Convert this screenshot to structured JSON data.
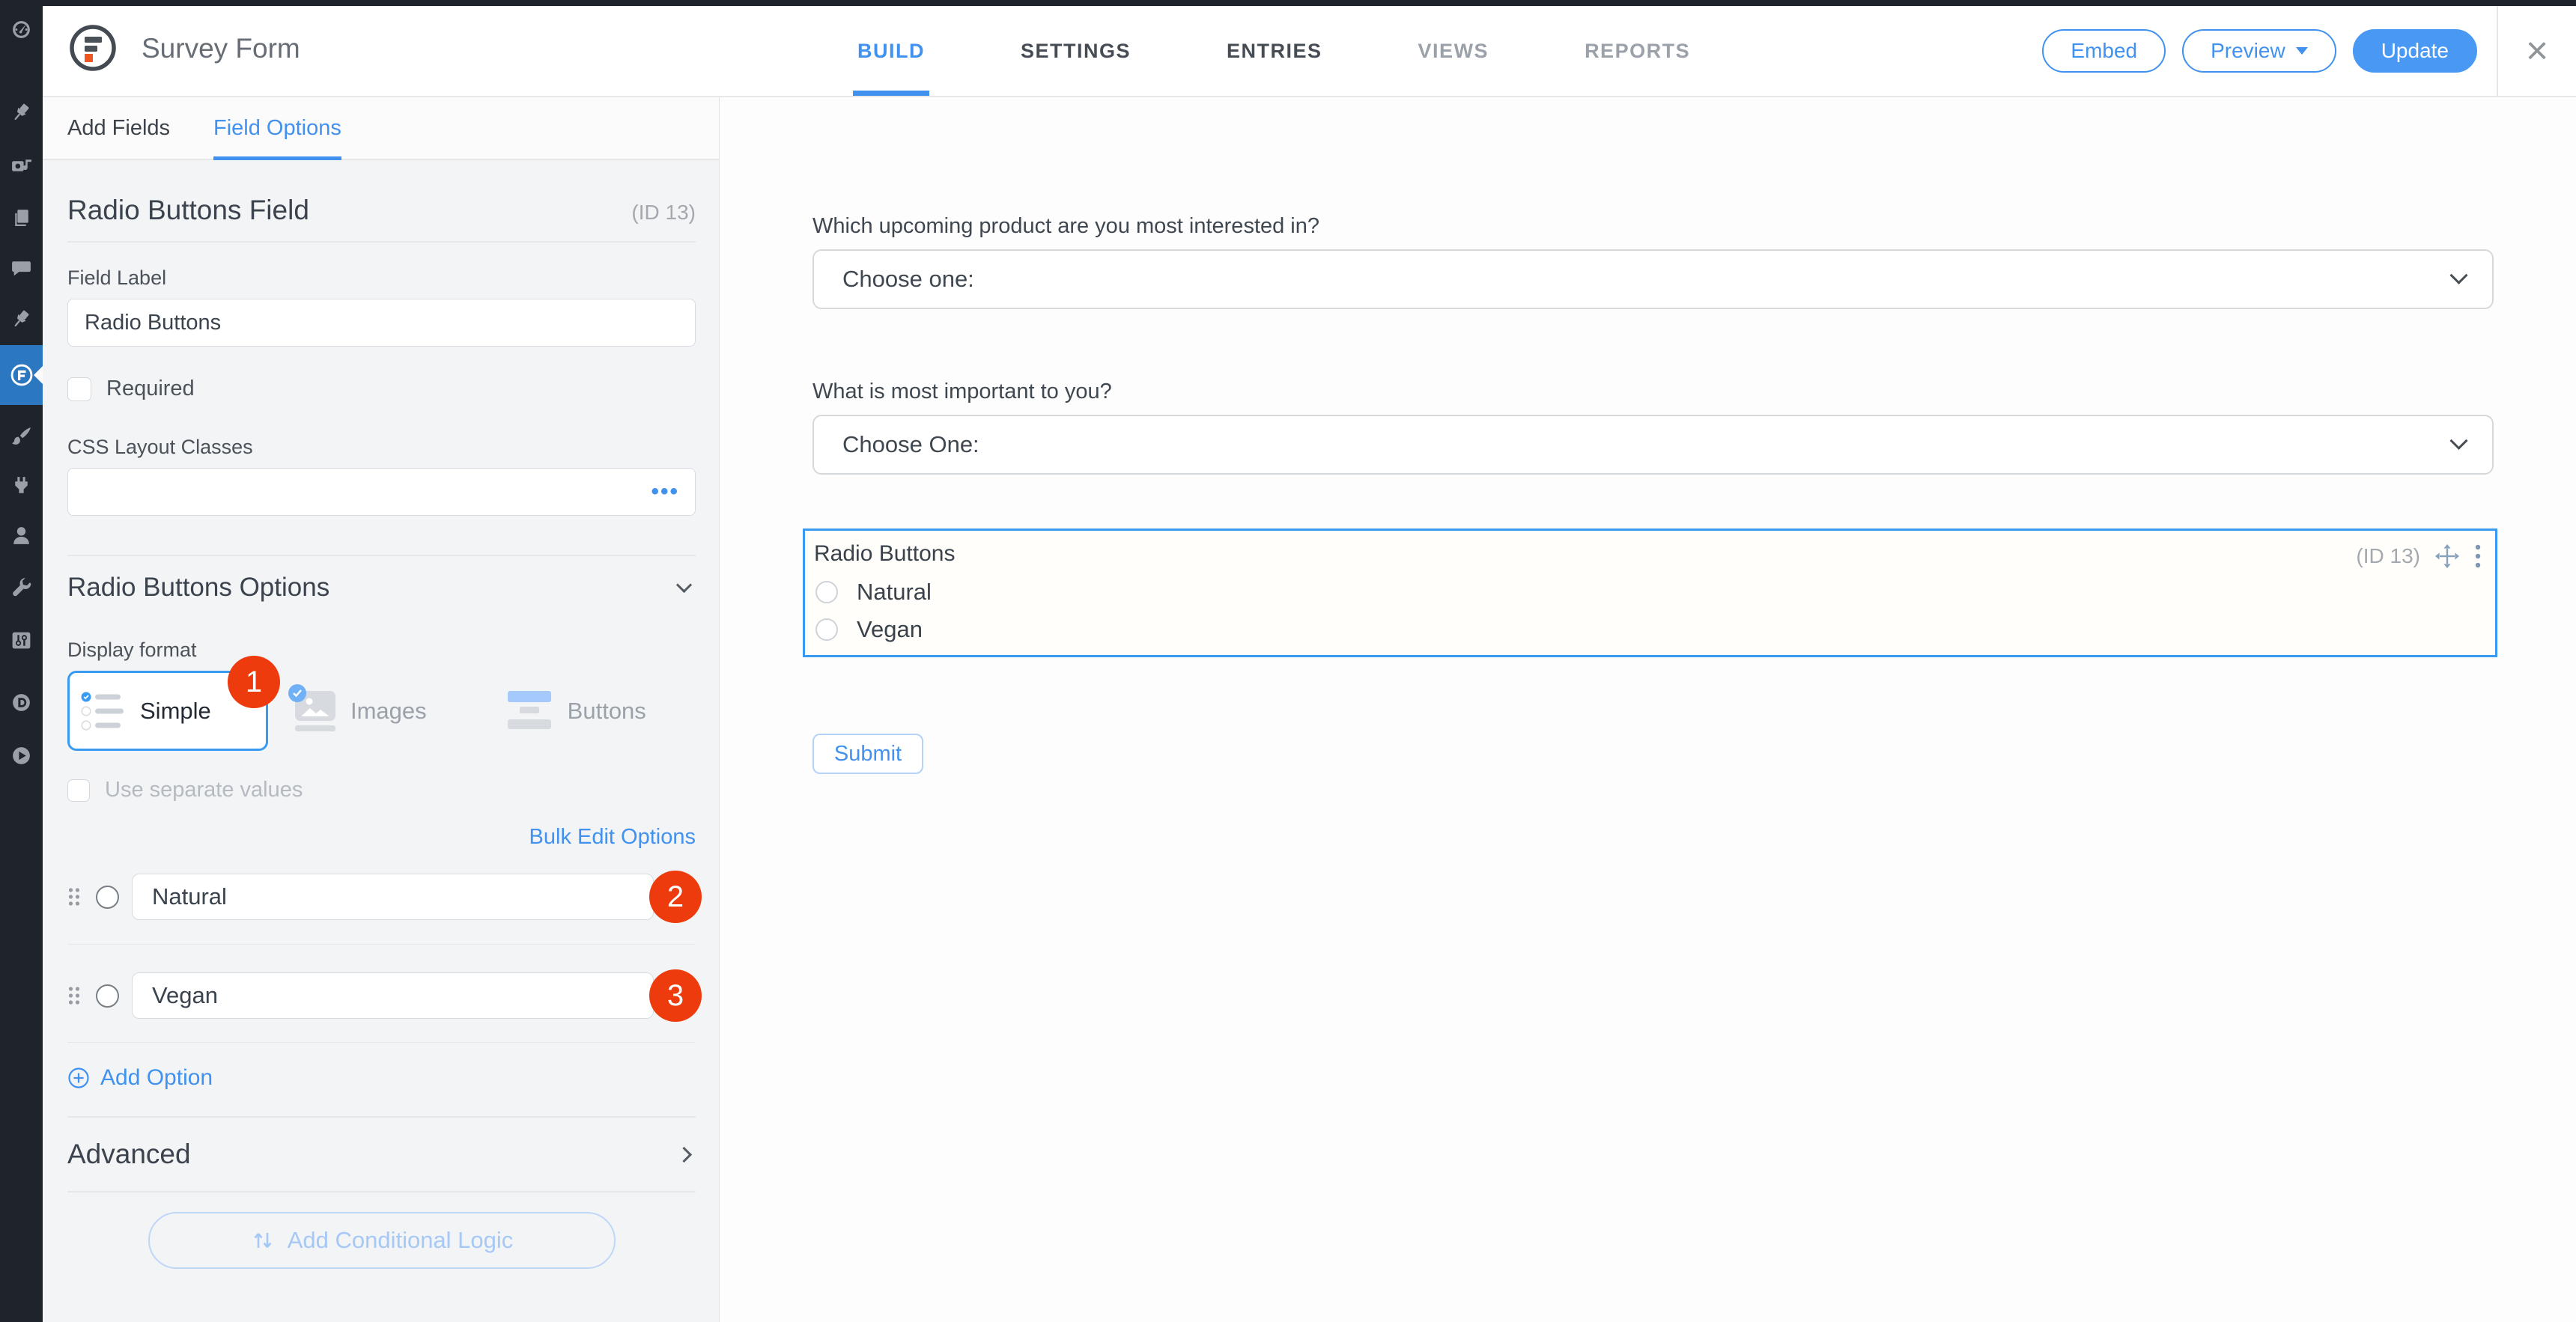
{
  "colors": {
    "accent_blue": "#4191ee",
    "update_button_blue": "#4898f4",
    "selection_blue": "#389af0",
    "badge_red": "#ee3b0d",
    "rail_bg": "#1f242a",
    "rail_active_bg": "#2b77c0",
    "sidebar_bg": "#f3f4f6",
    "logo_orange": "#f0561f"
  },
  "rail": {
    "items": [
      {
        "icon": "dashboard-icon"
      },
      {
        "icon": "pin-icon"
      },
      {
        "icon": "media-icon"
      },
      {
        "icon": "pages-icon"
      },
      {
        "icon": "comments-icon"
      },
      {
        "icon": "pin-icon-2"
      },
      {
        "icon": "formidable-icon",
        "active": true
      },
      {
        "icon": "brush-icon"
      },
      {
        "icon": "plug-icon"
      },
      {
        "icon": "users-icon"
      },
      {
        "icon": "wrench-icon"
      },
      {
        "icon": "sliders-icon"
      },
      {
        "icon": "d-circle-icon"
      },
      {
        "icon": "play-circle-icon"
      }
    ]
  },
  "header": {
    "logo_icon": "formidable-logo-icon",
    "title": "Survey Form",
    "tabs": [
      {
        "label": "BUILD",
        "state": "active"
      },
      {
        "label": "SETTINGS",
        "state": "normal"
      },
      {
        "label": "ENTRIES",
        "state": "normal"
      },
      {
        "label": "VIEWS",
        "state": "muted"
      },
      {
        "label": "REPORTS",
        "state": "muted"
      }
    ],
    "embed_label": "Embed",
    "preview_label": "Preview",
    "update_label": "Update",
    "close_icon": "×"
  },
  "sidebar": {
    "tab_add_fields": "Add Fields",
    "tab_field_options": "Field Options",
    "title": "Radio Buttons Field",
    "field_id": "(ID 13)",
    "field_label_label": "Field Label",
    "field_label_value": "Radio Buttons",
    "required_label": "Required",
    "css_label": "CSS Layout Classes",
    "css_value": "",
    "css_more": "•••",
    "options_section_title": "Radio Buttons Options",
    "display_format_label": "Display format",
    "formats": [
      {
        "label": "Simple",
        "badge": "1",
        "selected": true,
        "icon": "simple-list-icon"
      },
      {
        "label": "Images",
        "icon": "image-icon"
      },
      {
        "label": "Buttons",
        "icon": "buttons-stack-icon"
      }
    ],
    "use_separate_label": "Use separate values",
    "bulk_edit_label": "Bulk Edit Options",
    "options": [
      {
        "value": "Natural",
        "badge": "2"
      },
      {
        "value": "Vegan",
        "badge": "3"
      }
    ],
    "add_option_label": "Add Option",
    "advanced_title": "Advanced",
    "conditional_label": "Add Conditional Logic"
  },
  "canvas": {
    "fields": [
      {
        "type": "select",
        "label": "Which upcoming product are you most interested in?",
        "value": "Choose one:"
      },
      {
        "type": "select",
        "label": "What is most important to you?",
        "value": "Choose One:"
      },
      {
        "type": "radio",
        "label": "Radio Buttons",
        "id_tag": "(ID 13)",
        "options": [
          "Natural",
          "Vegan"
        ],
        "selected": true
      }
    ],
    "submit_label": "Submit"
  }
}
